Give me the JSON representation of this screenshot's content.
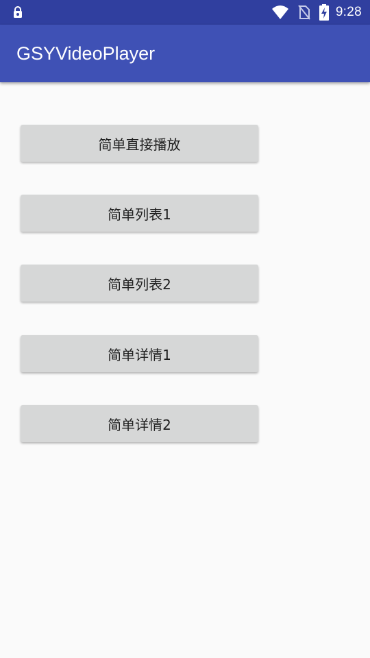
{
  "status_bar": {
    "time": "9:28",
    "icons": [
      "lock-icon",
      "wifi-icon",
      "no-sim-icon",
      "battery-charging-icon"
    ]
  },
  "app_bar": {
    "title": "GSYVideoPlayer",
    "background": "#3f51b5"
  },
  "buttons": [
    {
      "label": "简单直接播放"
    },
    {
      "label": "简单列表1"
    },
    {
      "label": "简单列表2"
    },
    {
      "label": "简单详情1"
    },
    {
      "label": "简单详情2"
    }
  ],
  "colors": {
    "status_bar": "#303f9f",
    "app_bar": "#3f51b5",
    "button": "#d6d7d7",
    "background": "#fafafa"
  }
}
